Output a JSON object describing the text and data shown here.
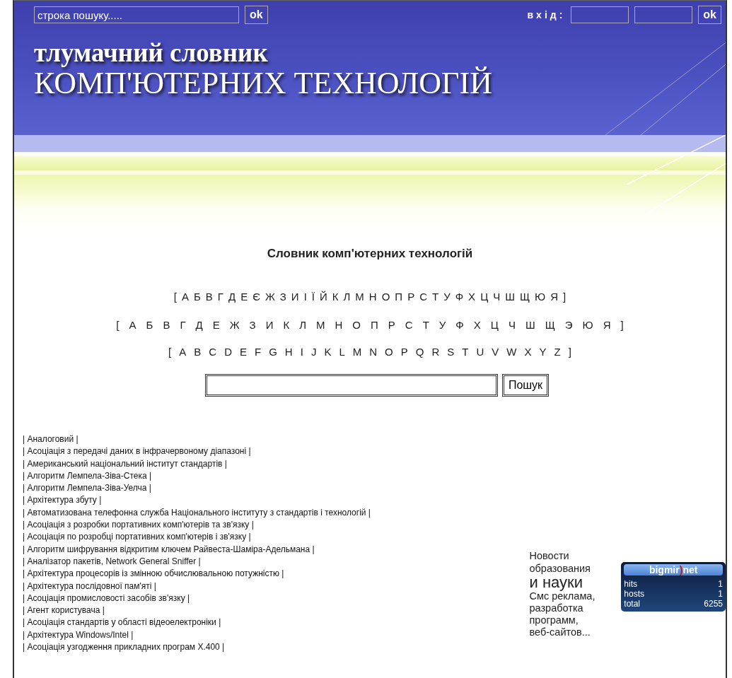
{
  "top_search": {
    "value": "строка пошуку.....",
    "button": "ok"
  },
  "login": {
    "label": "вхід:",
    "button": "ok"
  },
  "site_title": {
    "line_1": "тлумачний словник",
    "line_2": "КОМП'ЮТЕРНИХ ТЕХНОЛОГІЙ"
  },
  "heading": "Словник комп'ютерних технологій",
  "alphabets": [
    {
      "open": "[",
      "letters": [
        "А",
        "Б",
        "В",
        "Г",
        "Д",
        "Е",
        "Є",
        "Ж",
        "З",
        "И",
        "І",
        "Ї",
        "Й",
        "К",
        "Л",
        "М",
        "Н",
        "О",
        "П",
        "Р",
        "С",
        "Т",
        "У",
        "Ф",
        "Х",
        "Ц",
        "Ч",
        "Ш",
        "Щ",
        "Ю",
        "Я"
      ],
      "close": "]"
    },
    {
      "open": "[",
      "letters": [
        "А",
        "Б",
        "В",
        "Г",
        "Д",
        "Е",
        "Ж",
        "З",
        "И",
        "К",
        "Л",
        "М",
        "Н",
        "О",
        "П",
        "Р",
        "С",
        "Т",
        "У",
        "Ф",
        "Х",
        "Ц",
        "Ч",
        "Ш",
        "Щ",
        "Э",
        "Ю",
        "Я"
      ],
      "close": "]"
    },
    {
      "open": "[",
      "letters": [
        "A",
        "B",
        "C",
        "D",
        "E",
        "F",
        "G",
        "H",
        "I",
        "J",
        "K",
        "L",
        "M",
        "N",
        "O",
        "P",
        "Q",
        "R",
        "S",
        "T",
        "U",
        "V",
        "W",
        "X",
        "Y",
        "Z"
      ],
      "close": "]"
    }
  ],
  "search": {
    "button": "Пошук"
  },
  "terms": [
    "| Аналоговий |",
    "| Асоціація з передачі даних в інфрачервоному діапазоні |",
    "| Американський національний інститут стандартів |",
    "| Алгоритм Лемпела-Зіва-Стека |",
    "| Алгоритм Лемпела-Зіва-Уелча |",
    "| Архітектура збуту |",
    "| Автоматизована телефонна служба Національного інституту з стандартів і технологій |",
    "| Асоціація з розробки портативних комп'ютерів та зв'язку |",
    "| Асоціація по розробці портативних комп'ютерів і зв'язку |",
    "| Алгоритм шифрування відкритим ключем Райвеста-Шаміра-Адельмана |",
    "| Аналізатор пакетів, Network General Sniffer |",
    "| Архітектура процесорів із змінною обчислювальною потужністю |",
    "| Архітектура послідовної пам'яті |",
    "| Асоціація промисловості засобів зв'язку |",
    "| Агент користувача |",
    "| Асоціація стандартів у області відеоелектроніки |",
    "| Архітектура Windows/Intel |",
    "| Асоціація узгодження прикладних програм X.400 |"
  ],
  "ad": {
    "line_1": "Новости образования",
    "line_2": "и науки",
    "line_3": "Смс реклама, разработка программ, веб-сайтов..."
  },
  "counter": {
    "logo_parts": [
      "bigmir",
      ")",
      "net"
    ],
    "rows": [
      {
        "label": "hits",
        "value": "1"
      },
      {
        "label": "hosts",
        "value": "1"
      },
      {
        "label": "total",
        "value": "6255"
      }
    ]
  }
}
